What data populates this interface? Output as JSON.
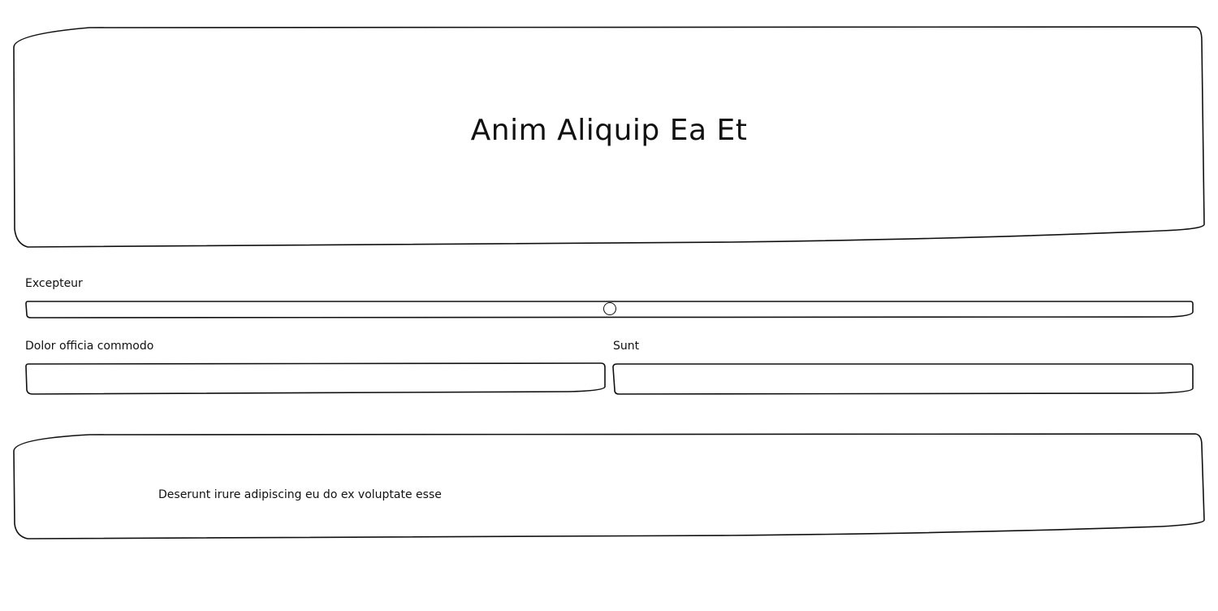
{
  "hero": {
    "title": "Anim Aliquip Ea Et"
  },
  "slider": {
    "label": "Excepteur",
    "value_fraction": 0.5
  },
  "fields": {
    "left": {
      "label": "Dolor officia commodo",
      "value": "",
      "placeholder": ""
    },
    "right": {
      "label": "Sunt",
      "value": "",
      "placeholder": ""
    }
  },
  "footer": {
    "text": "Deserunt irure adipiscing eu do ex voluptate esse"
  }
}
